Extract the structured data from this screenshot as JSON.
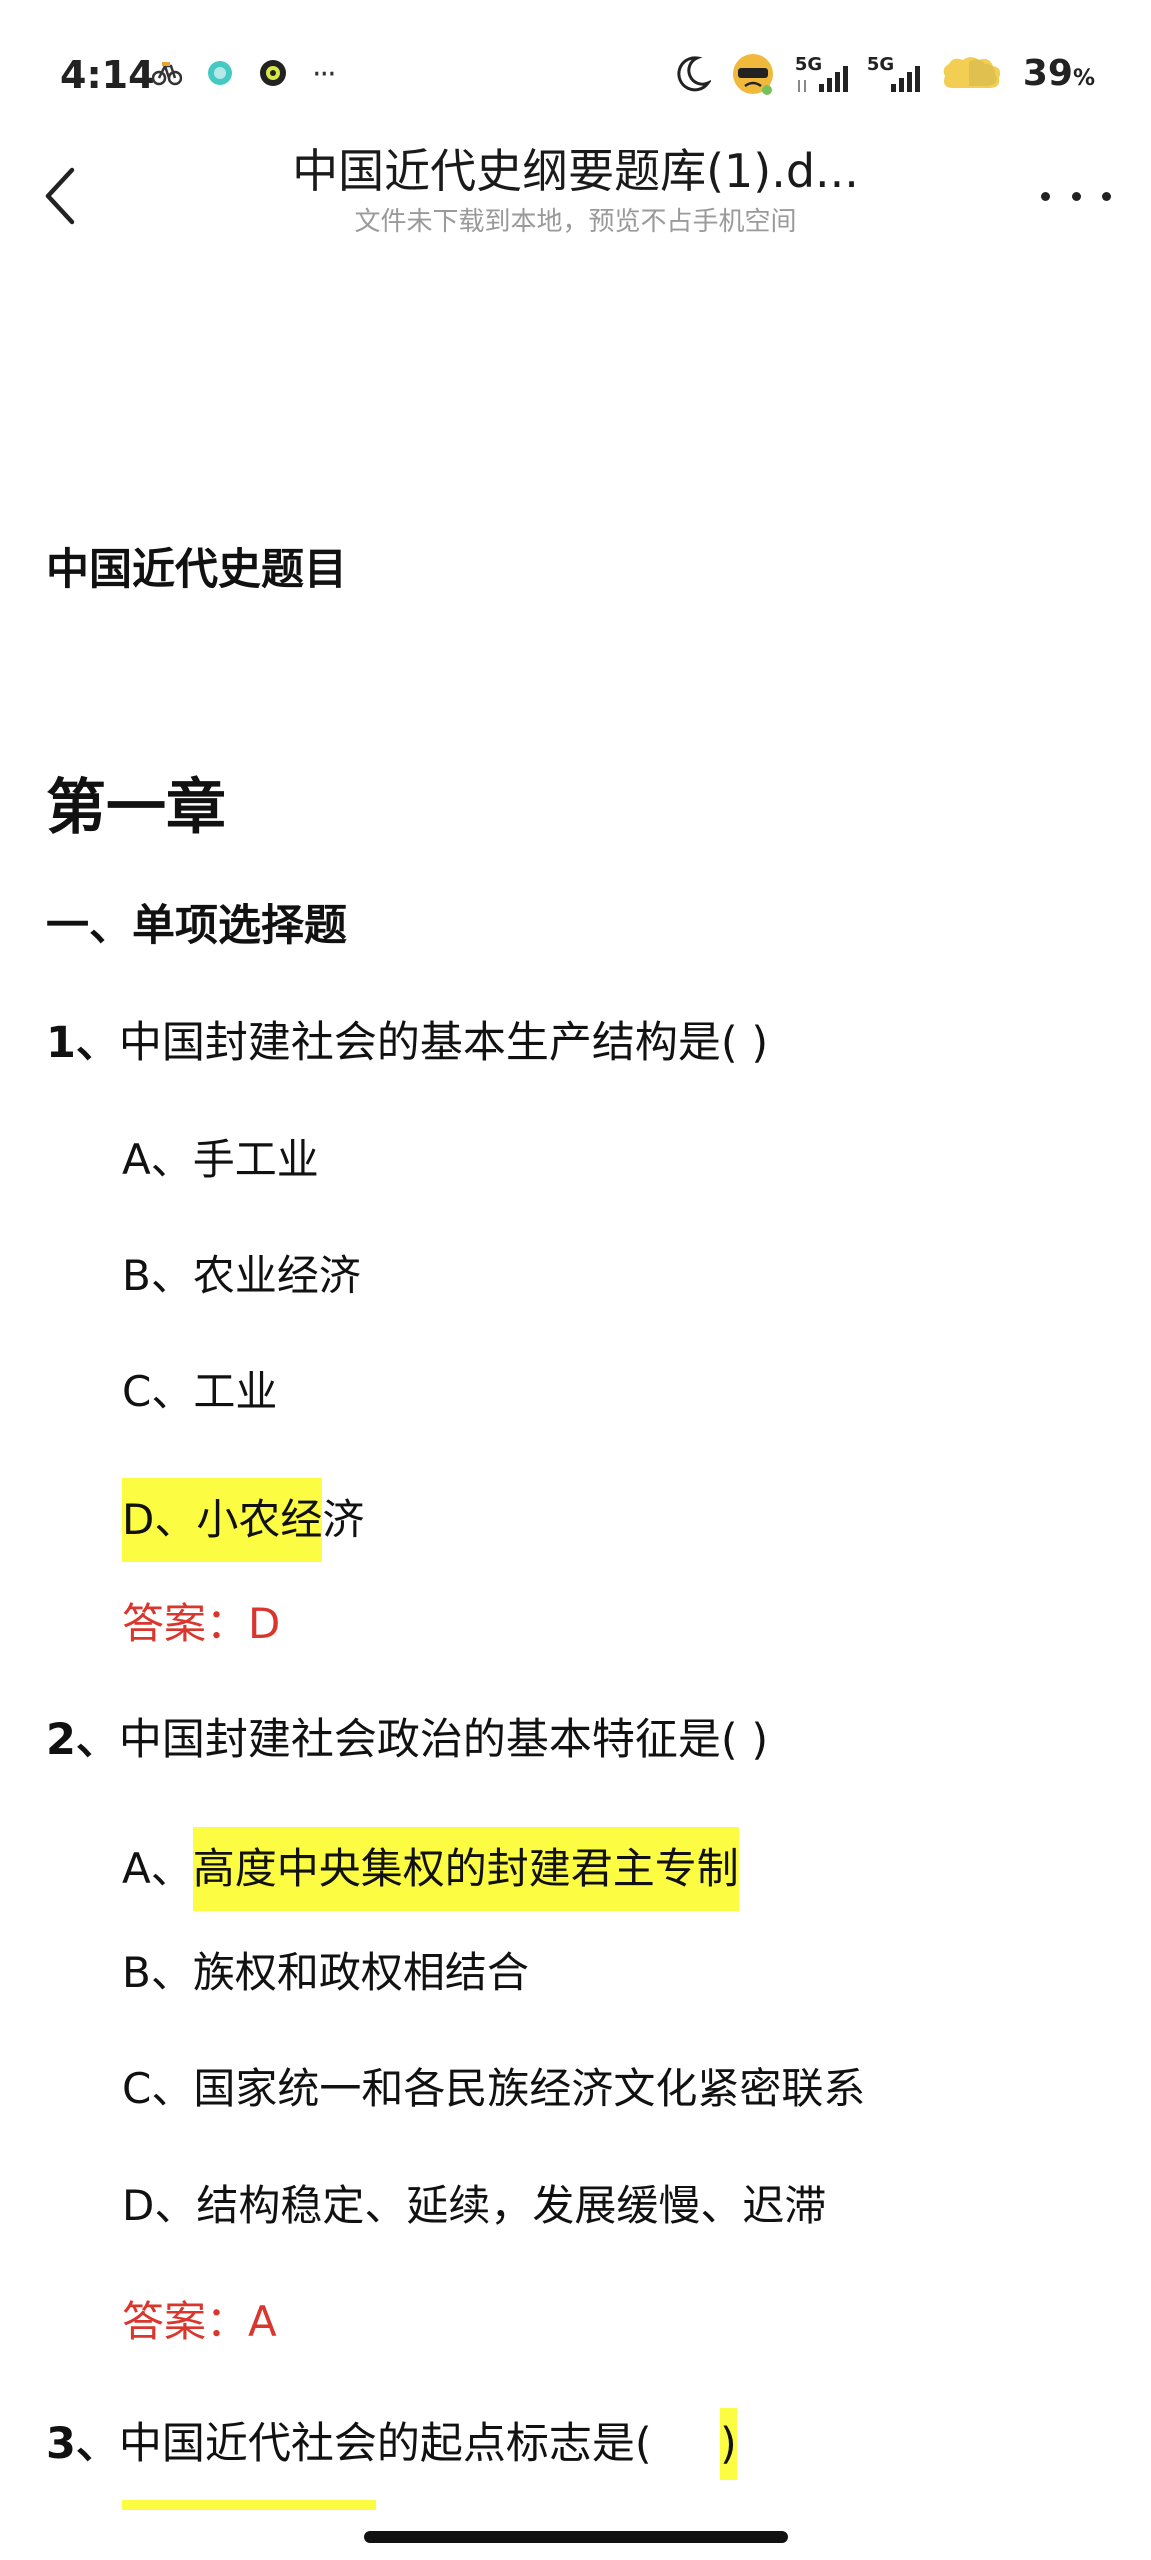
{
  "status_bar": {
    "time": "4:14",
    "left_icons": [
      "bike-icon",
      "soul-icon",
      "camera-ring-icon",
      "more-dots-icon"
    ],
    "overflow_dots": "···",
    "right_icons": [
      "moon-icon",
      "mascot-icon",
      "signal-5g-1-icon",
      "signal-5g-2-icon",
      "battery-icon"
    ],
    "network_1": "5G",
    "network_2": "5G",
    "battery_value": "39",
    "battery_unit": "%"
  },
  "header": {
    "title": "中国近代史纲要题库(1).d...",
    "subtitle": "文件未下载到本地，预览不占手机空间"
  },
  "document": {
    "heading": "中国近代史题目",
    "chapter": "第一章",
    "section": "一、单项选择题",
    "questions": [
      {
        "number": "1、",
        "text": "中国封建社会的基本生产结构是(     )",
        "options": [
          {
            "prefix": "A、",
            "text": "手工业"
          },
          {
            "prefix": "B、",
            "text": "农业经济"
          },
          {
            "prefix": "C、",
            "text": "工业"
          },
          {
            "prefix": "D、",
            "text": "小农经济",
            "highlighted_part": "D、小农经",
            "rest": "济"
          }
        ],
        "answer": "答案：D"
      },
      {
        "number": "2、",
        "text": "中国封建社会政治的基本特征是(     )",
        "options": [
          {
            "prefix": "A、",
            "text": "高度中央集权的封建君主专制"
          },
          {
            "prefix": "B、",
            "text": "族权和政权相结合"
          },
          {
            "prefix": "C、",
            "text": "国家统一和各民族经济文化紧密联系"
          },
          {
            "prefix": "D、",
            "text": "结构稳定、延续，发展缓慢、迟滞"
          }
        ],
        "answer": "答案：A"
      },
      {
        "number": "3、",
        "text_before": "中国近代社会的起点标志是(     ",
        "text_paren": ")"
      }
    ]
  },
  "colors": {
    "highlight": "#fcfc42",
    "answer": "#d9362e",
    "subtitle": "#9a9a9a"
  }
}
